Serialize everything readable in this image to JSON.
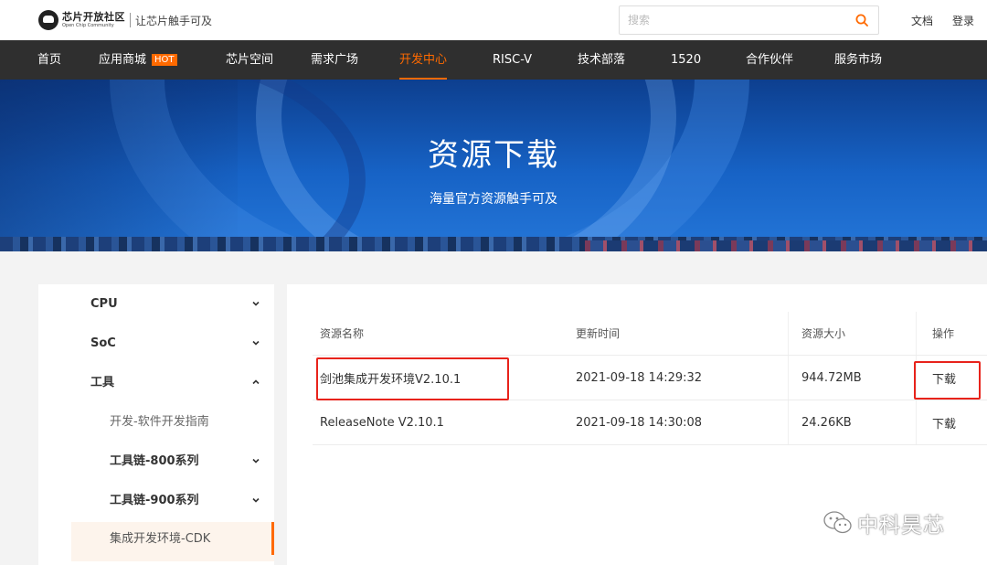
{
  "header": {
    "logo_cn": "芯片开放社区",
    "logo_en": "Open Chip Community",
    "slogan": "让芯片触手可及",
    "search_placeholder": "搜索",
    "links": [
      "文档",
      "登录"
    ]
  },
  "nav": {
    "items": [
      "首页",
      "应用商城",
      "芯片空间",
      "需求广场",
      "开发中心",
      "RISC-V",
      "技术部落",
      "1520",
      "合作伙伴",
      "服务市场"
    ],
    "hot_badge": "HOT",
    "active_index": 4
  },
  "banner": {
    "title": "资源下载",
    "subtitle": "海量官方资源触手可及"
  },
  "sidebar": {
    "items": [
      {
        "label": "CPU",
        "chevron": "down"
      },
      {
        "label": "SoC",
        "chevron": "down"
      },
      {
        "label": "工具",
        "chevron": "up"
      },
      {
        "label": "开发-软件开发指南",
        "chevron": ""
      },
      {
        "label": "工具链-800系列",
        "chevron": "down"
      },
      {
        "label": "工具链-900系列",
        "chevron": "down"
      },
      {
        "label": "集成开发环境-CDK",
        "chevron": ""
      }
    ],
    "selected_index": 6
  },
  "table": {
    "headers": [
      "资源名称",
      "更新时间",
      "资源大小",
      "操作"
    ],
    "rows": [
      [
        "剑池集成开发环境V2.10.1",
        "2021-09-18 14:29:32",
        "944.72MB",
        "下载"
      ],
      [
        "ReleaseNote V2.10.1",
        "2021-09-18 14:30:08",
        "24.26KB",
        "下载"
      ]
    ]
  },
  "watermark": "中科昊芯",
  "colors": {
    "accent": "#ff6a00",
    "nav_bg": "#2f2f2f",
    "highlight_box": "#e8231b"
  }
}
